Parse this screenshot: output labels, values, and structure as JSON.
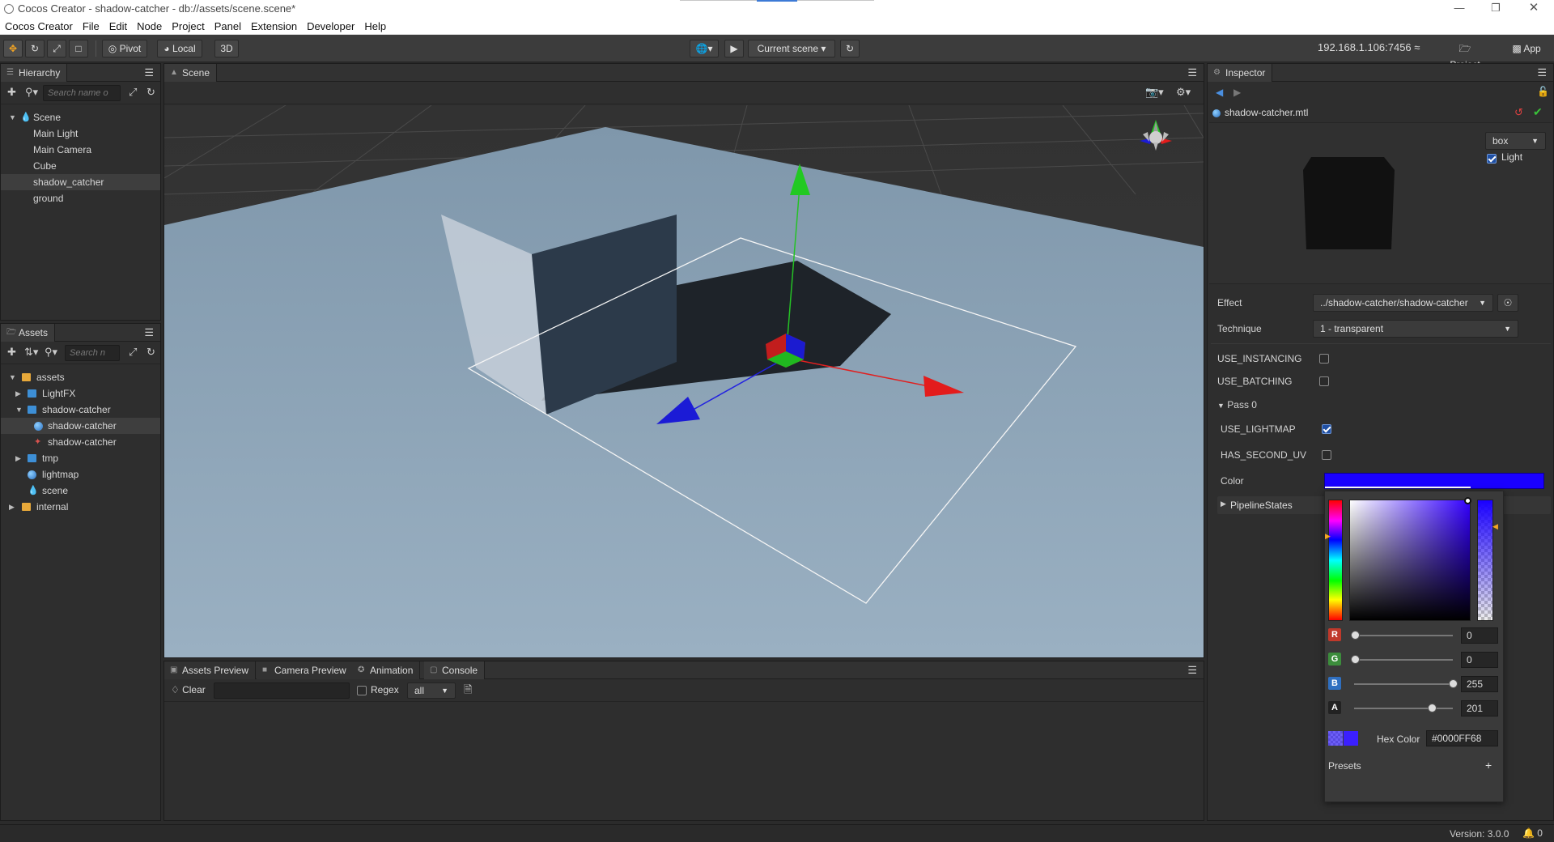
{
  "window": {
    "title": "Cocos Creator - shadow-catcher - db://assets/scene.scene*",
    "controls": [
      "minimize-icon",
      "restore-icon",
      "close-icon"
    ]
  },
  "menubar": [
    "Cocos Creator",
    "File",
    "Edit",
    "Node",
    "Project",
    "Panel",
    "Extension",
    "Developer",
    "Help"
  ],
  "toolbar": {
    "pivot_label": "Pivot",
    "local_label": "Local",
    "mode_3d_label": "3D",
    "scene_select": "Current scene",
    "ip_address": "192.168.1.106:7456",
    "project_label": "Project",
    "app_label": "App"
  },
  "hierarchy": {
    "title": "Hierarchy",
    "search_placeholder": "Search name o",
    "items": [
      {
        "label": "Scene",
        "type": "scene"
      },
      {
        "label": "Main Light",
        "type": "node"
      },
      {
        "label": "Main Camera",
        "type": "node"
      },
      {
        "label": "Cube",
        "type": "node"
      },
      {
        "label": "shadow_catcher",
        "type": "node",
        "selected": true
      },
      {
        "label": "ground",
        "type": "node"
      }
    ]
  },
  "assets": {
    "title": "Assets",
    "search_placeholder": "Search n",
    "items": [
      {
        "label": "assets",
        "type": "db"
      },
      {
        "label": "LightFX",
        "type": "folder"
      },
      {
        "label": "shadow-catcher",
        "type": "folder"
      },
      {
        "label": "shadow-catcher",
        "type": "material",
        "selected": true
      },
      {
        "label": "shadow-catcher",
        "type": "effect"
      },
      {
        "label": "tmp",
        "type": "folder"
      },
      {
        "label": "lightmap",
        "type": "material"
      },
      {
        "label": "scene",
        "type": "scene"
      },
      {
        "label": "internal",
        "type": "db"
      }
    ]
  },
  "scene_panel": {
    "title": "Scene"
  },
  "bottom_panel": {
    "tabs": [
      "Assets Preview",
      "Camera Preview",
      "Animation",
      "Console"
    ],
    "active_tab": "Console",
    "clear_label": "Clear",
    "regex_label": "Regex",
    "filter_value": "all"
  },
  "inspector": {
    "title": "Inspector",
    "asset_name": "shadow-catcher.mtl",
    "preview_shape": "box",
    "light_label": "Light",
    "light_checked": true,
    "effect_label": "Effect",
    "effect_value": "../shadow-catcher/shadow-catcher",
    "technique_label": "Technique",
    "technique_value": "1 - transparent",
    "use_instancing_label": "USE_INSTANCING",
    "use_instancing": false,
    "use_batching_label": "USE_BATCHING",
    "use_batching": false,
    "pass_label": "Pass 0",
    "use_lightmap_label": "USE_LIGHTMAP",
    "use_lightmap": true,
    "has_second_uv_label": "HAS_SECOND_UV",
    "has_second_uv": false,
    "color_label": "Color",
    "color_value": "#1a00ff",
    "pipeline_states_label": "PipelineStates"
  },
  "color_picker": {
    "r_label": "R",
    "r": "0",
    "g_label": "G",
    "g": "0",
    "b_label": "B",
    "b": "255",
    "a_label": "A",
    "a": "201",
    "hex_label": "Hex Color",
    "hex_value": "#0000FF68",
    "presets_label": "Presets",
    "add_preset": "+"
  },
  "statusbar": {
    "version": "Version: 3.0.0",
    "notifications": "0"
  },
  "colors": {
    "accent": "#f5a623",
    "selected_blue": "#1a00ff",
    "sky": "#8aa2b6"
  }
}
